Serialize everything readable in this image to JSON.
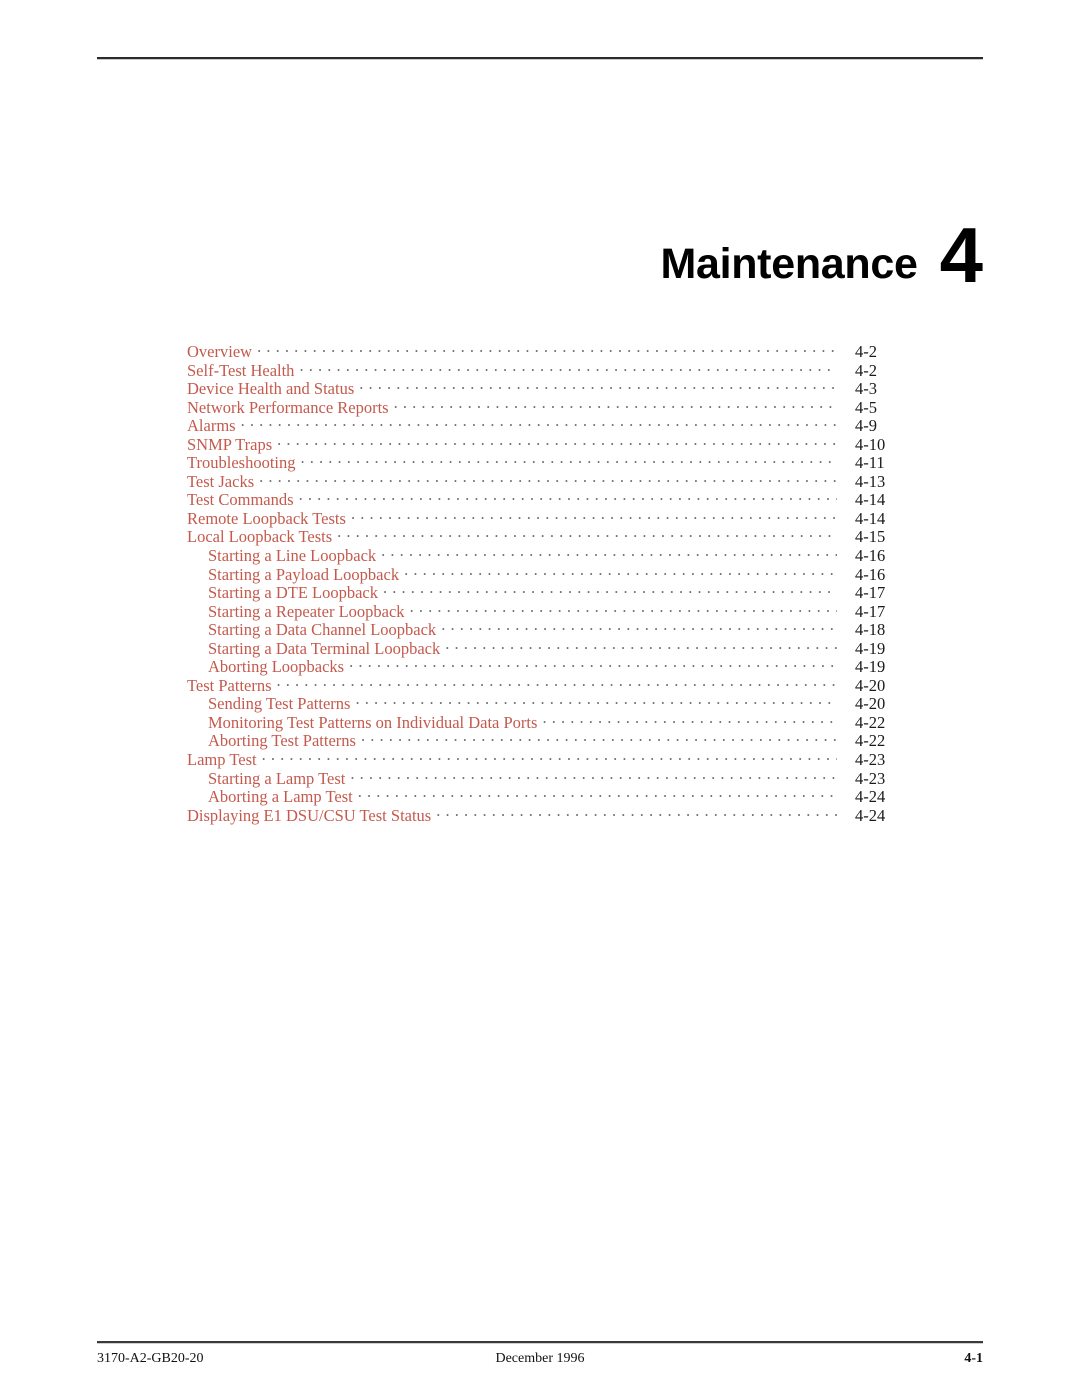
{
  "document": {
    "chapter_title": "Maintenance",
    "chapter_number": "4"
  },
  "toc": {
    "entries": [
      {
        "label": "Overview",
        "page": "4-2",
        "level": 1
      },
      {
        "label": "Self-Test Health",
        "page": "4-2",
        "level": 1
      },
      {
        "label": "Device Health and Status",
        "page": "4-3",
        "level": 1
      },
      {
        "label": "Network Performance Reports",
        "page": "4-5",
        "level": 1
      },
      {
        "label": "Alarms",
        "page": "4-9",
        "level": 1
      },
      {
        "label": "SNMP Traps",
        "page": "4-10",
        "level": 1
      },
      {
        "label": "Troubleshooting",
        "page": "4-11",
        "level": 1
      },
      {
        "label": "Test Jacks",
        "page": "4-13",
        "level": 1
      },
      {
        "label": "Test Commands",
        "page": "4-14",
        "level": 1
      },
      {
        "label": "Remote Loopback Tests",
        "page": "4-14",
        "level": 1
      },
      {
        "label": "Local Loopback Tests",
        "page": "4-15",
        "level": 1
      },
      {
        "label": "Starting a Line Loopback",
        "page": "4-16",
        "level": 2
      },
      {
        "label": "Starting a Payload Loopback",
        "page": "4-16",
        "level": 2
      },
      {
        "label": "Starting a DTE Loopback",
        "page": "4-17",
        "level": 2
      },
      {
        "label": "Starting a Repeater Loopback",
        "page": "4-17",
        "level": 2
      },
      {
        "label": "Starting a Data Channel Loopback",
        "page": "4-18",
        "level": 2
      },
      {
        "label": "Starting a Data Terminal Loopback",
        "page": "4-19",
        "level": 2
      },
      {
        "label": "Aborting Loopbacks",
        "page": "4-19",
        "level": 2
      },
      {
        "label": "Test Patterns",
        "page": "4-20",
        "level": 1
      },
      {
        "label": "Sending Test Patterns",
        "page": "4-20",
        "level": 2
      },
      {
        "label": "Monitoring Test Patterns on Individual Data Ports",
        "page": "4-22",
        "level": 2
      },
      {
        "label": "Aborting Test Patterns",
        "page": "4-22",
        "level": 2
      },
      {
        "label": "Lamp Test",
        "page": "4-23",
        "level": 1
      },
      {
        "label": "Starting a Lamp Test",
        "page": "4-23",
        "level": 2
      },
      {
        "label": "Aborting a Lamp Test",
        "page": "4-24",
        "level": 2
      },
      {
        "label": "Displaying E1 DSU/CSU Test Status",
        "page": "4-24",
        "level": 1
      }
    ]
  },
  "footer": {
    "document_number": "3170-A2-GB20-20",
    "date": "December 1996",
    "page_number": "4-1"
  },
  "colors": {
    "toc_text": "#c45a4d",
    "body_text": "#111111",
    "leader_dots": "#6f6f6f"
  }
}
